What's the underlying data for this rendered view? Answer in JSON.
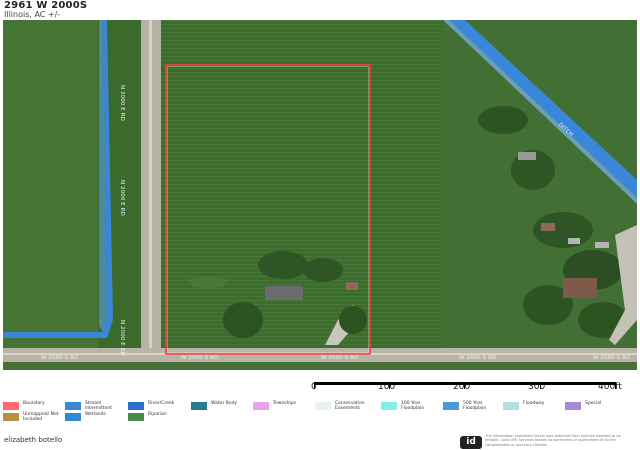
{
  "header": {
    "title": "2961 W 2000S",
    "subtitle": "Illinois,  AC +/-"
  },
  "map": {
    "road_labels": {
      "vertical_1": "N 2000 E RD",
      "vertical_2": "N 2000 E RD",
      "vertical_3": "N 2000 E RD",
      "bottom_1": "W 2000 S RD",
      "bottom_2": "W 2000 S RD",
      "bottom_3": "W 2000 S RD",
      "bottom_4": "W 2000 S RD",
      "bottom_5": "W 2000 S RD",
      "ditch": "DITCH"
    },
    "colors": {
      "boundary": "#ff3b3b",
      "stream": "#3a86d9",
      "field": "#3f6f2e"
    }
  },
  "scale": {
    "labels": [
      "0",
      "100",
      "200",
      "300",
      "400ft"
    ]
  },
  "legend": {
    "items": [
      {
        "label": "Boundary",
        "color": "#ff6b6b"
      },
      {
        "label": "Stream Intermittent",
        "color": "#3a86d9"
      },
      {
        "label": "River/Creek",
        "color": "#2f6fd0"
      },
      {
        "label": "Water Body",
        "color": "#2a7e8a"
      },
      {
        "label": "Townships",
        "color": "#e6a3e6"
      },
      {
        "label": "Conservation Easements",
        "color": "#e8f5ef"
      },
      {
        "label": "100 Year Floodplain",
        "color": "#86ecf0"
      },
      {
        "label": "500 Year Floodplain",
        "color": "#4a9ad9"
      },
      {
        "label": "Floodway",
        "color": "#b7dde6"
      },
      {
        "label": "Special",
        "color": "#a78bd2"
      },
      {
        "label": "Unmapped/ Not Included",
        "color": "#b8913e"
      },
      {
        "label": "Wetlands",
        "color": "#2f88d8"
      },
      {
        "label": "Riparian",
        "color": "#4a8a4a"
      }
    ]
  },
  "footer": {
    "user": "elizabeth botello",
    "logo": "id",
    "disclaimer": "The information contained herein was obtained from sources deemed to be reliable. Land id® Services makes no warranties or guarantees as to the completeness or accuracy thereof."
  }
}
